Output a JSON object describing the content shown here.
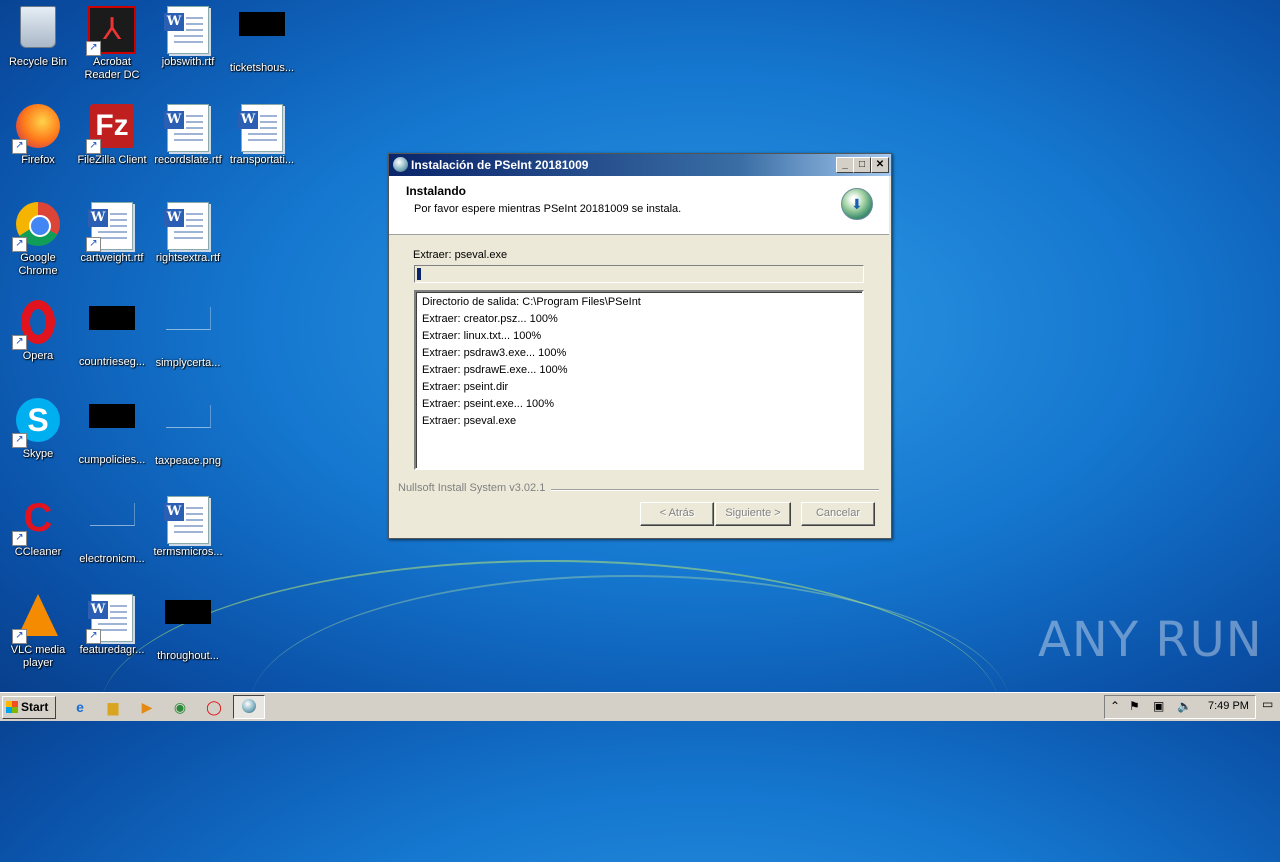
{
  "desktop": {
    "icons": [
      {
        "label": "Recycle Bin",
        "kind": "recycle-bin-icon"
      },
      {
        "label": "Acrobat Reader DC",
        "kind": "acrobat-icon"
      },
      {
        "label": "jobswith.rtf",
        "kind": "word-doc-icon"
      },
      {
        "label": "ticketshous...",
        "kind": "black-thumbnail-icon"
      },
      {
        "label": "Firefox",
        "kind": "firefox-icon"
      },
      {
        "label": "FileZilla Client",
        "kind": "filezilla-icon"
      },
      {
        "label": "recordslate.rtf",
        "kind": "word-doc-icon"
      },
      {
        "label": "transportati...",
        "kind": "word-doc-icon"
      },
      {
        "label": "Google Chrome",
        "kind": "chrome-icon"
      },
      {
        "label": "cartweight.rtf",
        "kind": "word-doc-icon"
      },
      {
        "label": "rightsextra.rtf",
        "kind": "word-doc-icon"
      },
      {
        "label": "Opera",
        "kind": "opera-icon"
      },
      {
        "label": "countrieseg...",
        "kind": "black-thumbnail-icon"
      },
      {
        "label": "simplycerta...",
        "kind": "blank-thumbnail-icon"
      },
      {
        "label": "Skype",
        "kind": "skype-icon"
      },
      {
        "label": "cumpolicies...",
        "kind": "black-thumbnail-icon"
      },
      {
        "label": "taxpeace.png",
        "kind": "blank-thumbnail-icon"
      },
      {
        "label": "CCleaner",
        "kind": "ccleaner-icon"
      },
      {
        "label": "electronicm...",
        "kind": "blank-thumbnail-icon"
      },
      {
        "label": "termsmicros...",
        "kind": "word-doc-icon"
      },
      {
        "label": "VLC media player",
        "kind": "vlc-icon"
      },
      {
        "label": "featuredagr...",
        "kind": "word-doc-icon"
      },
      {
        "label": "throughout...",
        "kind": "black-thumbnail-icon"
      }
    ],
    "watermark": "ANY RUN"
  },
  "dialog": {
    "title": "Instalación de PSeInt 20181009",
    "header_title": "Instalando",
    "header_subtitle": "Por favor espere mientras PSeInt 20181009 se instala.",
    "status": "Extraer: pseval.exe",
    "progress_fraction": 0.01,
    "log": [
      "Directorio de salida: C:\\Program Files\\PSeInt",
      "Extraer: creator.psz... 100%",
      "Extraer: linux.txt... 100%",
      "Extraer: psdraw3.exe... 100%",
      "Extraer: psdrawE.exe... 100%",
      "Extraer: pseint.dir",
      "Extraer: pseint.exe... 100%",
      "Extraer: pseval.exe"
    ],
    "branding": "Nullsoft Install System v3.02.1",
    "buttons": {
      "back": "< Atrás",
      "next": "Siguiente >",
      "cancel": "Cancelar"
    }
  },
  "taskbar": {
    "start_label": "Start",
    "clock": "7:49 PM"
  }
}
